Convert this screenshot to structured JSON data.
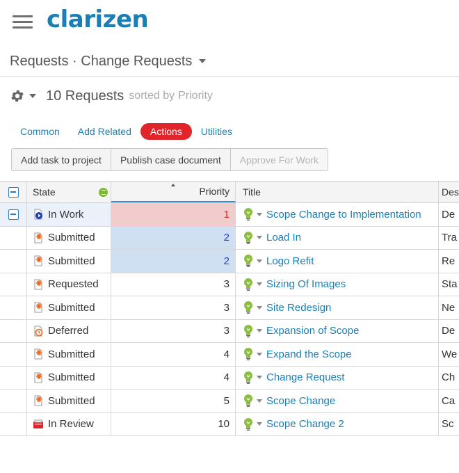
{
  "app": {
    "logo": "clarizen"
  },
  "breadcrumb": {
    "text": "Requests · Change Requests"
  },
  "list_header": {
    "count": "10 Requests",
    "sorted_label": "sorted by",
    "sorted_value": "Priority"
  },
  "tabs": [
    {
      "label": "Common"
    },
    {
      "label": "Add Related"
    },
    {
      "label": "Actions"
    },
    {
      "label": "Utilities"
    }
  ],
  "actions": [
    {
      "label": "Add task to project"
    },
    {
      "label": "Publish case document"
    },
    {
      "label": "Approve For Work"
    }
  ],
  "columns": {
    "state": "State",
    "priority": "Priority",
    "title": "Title",
    "desc": "Des"
  },
  "rows": [
    {
      "state": "In Work",
      "state_icon": "in-work-icon",
      "priority": "1",
      "title": "Scope Change to Implementation",
      "desc": "De"
    },
    {
      "state": "Submitted",
      "state_icon": "submitted-icon",
      "priority": "2",
      "title": "Load In",
      "desc": "Tra"
    },
    {
      "state": "Submitted",
      "state_icon": "submitted-icon",
      "priority": "2",
      "title": "Logo Refit",
      "desc": "Re"
    },
    {
      "state": "Requested",
      "state_icon": "requested-icon",
      "priority": "3",
      "title": "Sizing Of Images",
      "desc": "Sta"
    },
    {
      "state": "Submitted",
      "state_icon": "submitted-icon",
      "priority": "3",
      "title": "Site Redesign",
      "desc": "Ne"
    },
    {
      "state": "Deferred",
      "state_icon": "deferred-icon",
      "priority": "3",
      "title": "Expansion of Scope",
      "desc": "De"
    },
    {
      "state": "Submitted",
      "state_icon": "submitted-icon",
      "priority": "4",
      "title": "Expand the Scope",
      "desc": "We"
    },
    {
      "state": "Submitted",
      "state_icon": "submitted-icon",
      "priority": "4",
      "title": "Change Request",
      "desc": "Ch"
    },
    {
      "state": "Submitted",
      "state_icon": "submitted-icon",
      "priority": "5",
      "title": "Scope Change",
      "desc": "Ca"
    },
    {
      "state": "In Review",
      "state_icon": "in-review-icon",
      "priority": "10",
      "title": "Scope Change 2",
      "desc": "Sc"
    }
  ],
  "colors": {
    "brand": "#1a7fb5",
    "accent_red": "#e0262a",
    "priority_high_bg": "#f2cccc",
    "priority_mid_bg": "#cfe0f2",
    "bulb_green": "#8cbf3f"
  }
}
